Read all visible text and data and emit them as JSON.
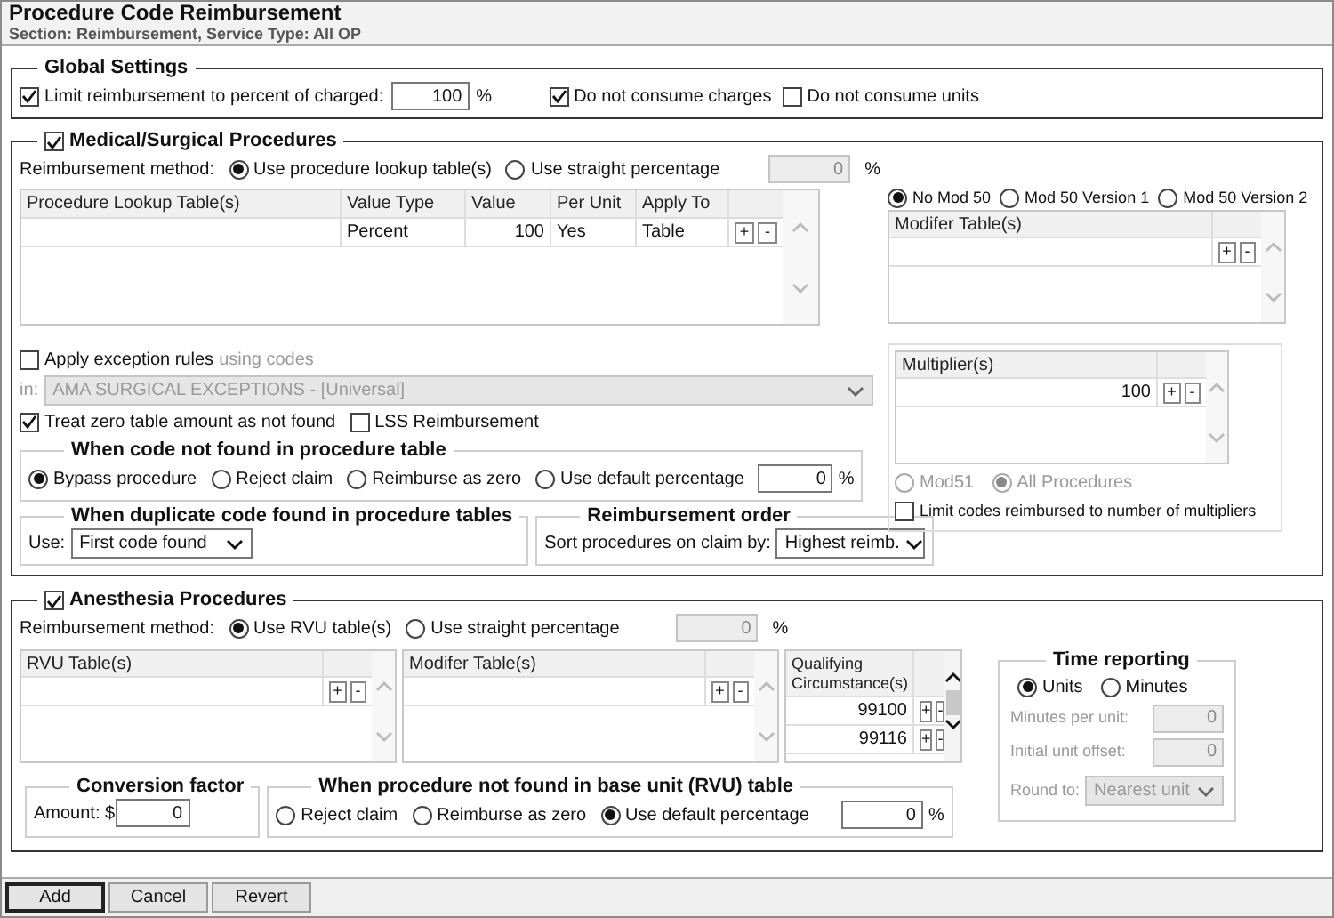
{
  "header": {
    "title": "Procedure Code Reimbursement",
    "subtitle": "Section: Reimbursement, Service Type: All OP"
  },
  "global_settings": {
    "title": "Global Settings",
    "limit": {
      "label": "Limit reimbursement to percent of charged:",
      "checked": true,
      "value": "100",
      "unit": "%"
    },
    "options": [
      {
        "label": "Do not consume charges",
        "checked": true
      },
      {
        "label": "Do not consume units",
        "checked": false
      }
    ]
  },
  "medical": {
    "title": "Medical/Surgical Procedures",
    "checked": true,
    "method_label": "Reimbursement method:",
    "methods": [
      {
        "label": "Use procedure lookup table(s)",
        "selected": true
      },
      {
        "label": "Use straight percentage",
        "selected": false
      }
    ],
    "percentage": {
      "value": "0",
      "unit": "%",
      "disabled": true
    },
    "lookup_table": {
      "columns": [
        "Procedure Lookup Table(s)",
        "Value Type",
        "Value",
        "Per Unit",
        "Apply To"
      ],
      "rows": [
        {
          "cells": [
            null,
            "Percent",
            "100",
            "Yes",
            "Table"
          ],
          "buttons": [
            "+",
            "-"
          ]
        }
      ]
    },
    "mod50_options": [
      {
        "label": "No Mod 50",
        "selected": true
      },
      {
        "label": "Mod 50 Version 1",
        "selected": false
      },
      {
        "label": "Mod 50 Version 2",
        "selected": false
      }
    ],
    "modifier_table": {
      "columns": [
        "Modifer Table(s)"
      ],
      "rows": [
        {
          "buttons": [
            "+",
            "-"
          ]
        }
      ]
    },
    "exception_rules": {
      "label": "Apply exception rules",
      "hint": "using codes",
      "checked": false,
      "in_label": "in:",
      "codes": {
        "value": "AMA SURGICAL EXCEPTIONS - [Universal]",
        "disabled": true
      }
    },
    "options": [
      {
        "label": "Treat zero table amount as not found",
        "checked": true
      },
      {
        "label": "LSS Reimbursement",
        "checked": false
      }
    ],
    "multiplier": {
      "table": {
        "columns": [
          "Multiplier(s)"
        ],
        "rows": [
          {
            "cells": [
              "100"
            ],
            "buttons": [
              "+",
              "-"
            ]
          }
        ]
      },
      "scope": [
        {
          "label": "Mod51",
          "selected": false,
          "disabled": true
        },
        {
          "label": "All Procedures",
          "selected": true,
          "disabled": true
        }
      ],
      "limit": {
        "label": "Limit codes reimbursed to number of multipliers",
        "checked": false
      }
    },
    "not_found": {
      "title": "When code not found in procedure table",
      "options": [
        {
          "label": "Bypass procedure",
          "selected": true
        },
        {
          "label": "Reject claim",
          "selected": false
        },
        {
          "label": "Reimburse as zero",
          "selected": false
        },
        {
          "label": "Use default percentage",
          "selected": false
        }
      ],
      "default_percentage": {
        "value": "0",
        "unit": "%"
      }
    },
    "duplicate": {
      "title": "When duplicate code found in procedure tables",
      "label": "Use:",
      "select": {
        "value": "First code found"
      }
    },
    "order": {
      "title": "Reimbursement order",
      "label": "Sort procedures on claim by:",
      "select": {
        "value": "Highest reimb."
      }
    }
  },
  "anesthesia": {
    "title": "Anesthesia Procedures",
    "checked": true,
    "method_label": "Reimbursement method:",
    "methods": [
      {
        "label": "Use RVU table(s)",
        "selected": true
      },
      {
        "label": "Use straight percentage",
        "selected": false
      }
    ],
    "percentage": {
      "value": "0",
      "unit": "%",
      "disabled": true
    },
    "rvu_table": {
      "columns": [
        "RVU Table(s)"
      ],
      "rows": [
        {
          "buttons": [
            "+",
            "-"
          ]
        }
      ]
    },
    "modifier_table": {
      "columns": [
        "Modifer Table(s)"
      ],
      "rows": [
        {
          "buttons": [
            "+",
            "-"
          ]
        }
      ]
    },
    "qualifying_table": {
      "columns": [
        "Qualifying Circumstance(s)"
      ],
      "rows": [
        {
          "cells": [
            "99100"
          ],
          "buttons": [
            "+",
            "-"
          ]
        },
        {
          "cells": [
            "99116"
          ],
          "buttons": [
            "+",
            "-"
          ]
        }
      ]
    },
    "time_reporting": {
      "title": "Time reporting",
      "options": [
        {
          "label": "Units",
          "selected": true
        },
        {
          "label": "Minutes",
          "selected": false
        }
      ],
      "fields": [
        {
          "label": "Minutes per unit:",
          "value": "0",
          "disabled": true
        },
        {
          "label": "Initial unit offset:",
          "value": "0",
          "disabled": true
        }
      ],
      "round_to": {
        "label": "Round to:",
        "value": "Nearest unit",
        "disabled": true
      }
    },
    "conversion_factor": {
      "title": "Conversion factor",
      "label": "Amount: $",
      "value": "0"
    },
    "not_found": {
      "title": "When procedure not found in base unit (RVU) table",
      "options": [
        {
          "label": "Reject claim",
          "selected": false
        },
        {
          "label": "Reimburse as zero",
          "selected": false
        },
        {
          "label": "Use default percentage",
          "selected": true
        }
      ],
      "default_percentage": {
        "value": "0",
        "unit": "%"
      }
    }
  },
  "buttons": [
    {
      "label": "Add",
      "default": true
    },
    {
      "label": "Cancel",
      "default": false
    },
    {
      "label": "Revert",
      "default": false
    }
  ]
}
